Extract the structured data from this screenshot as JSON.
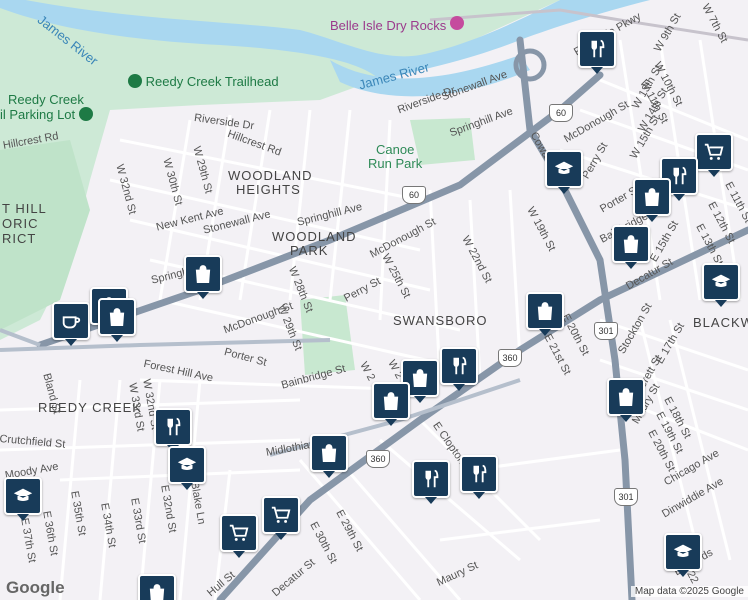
{
  "map": {
    "pois": {
      "belle_isle": "Belle Isle Dry Rocks",
      "trailhead": "Reedy Creek Trailhead",
      "parking_line1": "Reedy Creek",
      "parking_line2": "il Parking Lot",
      "canoe_line1": "Canoe",
      "canoe_line2": "Run Park",
      "historic_line1": "T HILL",
      "historic_line2": "ORIC",
      "historic_line3": "RICT"
    },
    "water": {
      "james_left": "James River",
      "james_right": "James River"
    },
    "neighborhoods": {
      "woodland_heights_1": "WOODLAND",
      "woodland_heights_2": "HEIGHTS",
      "woodland_park_1": "WOODLAND",
      "woodland_park_2": "PARK",
      "swansboro": "SWANSBORO",
      "reedy_creek": "REEDY CREEK",
      "blackwell": "BLACKW"
    },
    "streets": {
      "s1": "Hillcrest Rd",
      "s2": "Riverside Dr",
      "s3": "Hillcrest Rd",
      "s4": "W 29th St",
      "s5": "W 30th St",
      "s6": "W 32nd St",
      "s7": "New Kent Ave",
      "s8": "Stonewall Ave",
      "s9": "Springhill Ave",
      "s10": "McDonough St",
      "s11": "Perry St",
      "s12": "W 25th St",
      "s13": "W 22nd St",
      "s14": "W 28th St",
      "s15": "W 29th St",
      "s16": "McDonough St",
      "s17": "Porter St",
      "s18": "Forest Hill Ave",
      "s19": "Bainbridge St",
      "s20": "Riverside Dr",
      "s21": "Stonewall Ave",
      "s22": "Springhill Ave",
      "s23": "Cowardin Ave",
      "s24": "McDonough St",
      "s25": "W 19th St",
      "s26": "Perry St",
      "s27": "Porter St",
      "s28": "Bainbridge St",
      "s29": "E 20th St",
      "s30": "E 21st St",
      "s31": "Decatur St",
      "s32": "E 15th St",
      "s33": "Stockton St",
      "s34": "E 17th St",
      "s35": "Everett St",
      "s36": "Maury St",
      "s37": "E 18th St",
      "s38": "E 19th St",
      "s39": "E 20th St",
      "s40": "Chicago Ave",
      "s41": "Dinwiddie Ave",
      "s42": "W 7th St",
      "s43": "W 9th St",
      "s44": "W 10th St",
      "s45": "W 11th St",
      "s46": "W 13th St",
      "s47": "W 14th St",
      "s48": "W 15th St",
      "s49": "E 11th St",
      "s50": "E 12th St",
      "s51": "E 13th St",
      "s52": "Midlothian Tpke",
      "s53": "Crutchfield St",
      "s54": "Moody Ave",
      "s55": "Bland St",
      "s56": "W 33rd St",
      "s57": "W 32nd St",
      "s58": "E 32nd St",
      "s59": "Blake Ln",
      "s60": "E 34th St",
      "s61": "E 33rd St",
      "s62": "E 35th St",
      "s63": "E 36th St",
      "s64": "E 37th St",
      "s65": "Hull St",
      "s66": "Decatur St",
      "s67": "E 30th St",
      "s68": "E 29th St",
      "s69": "E Clopton St",
      "s70": "Maury St",
      "s71": "Edwards",
      "s72": "E 22",
      "s73": "Riverside Pkwy",
      "s74": "W 25th St",
      "s75": "Springhill",
      "s76": "W 21st St",
      "s77": "W 2"
    },
    "shields": {
      "r60a": "60",
      "r60b": "60",
      "r360a": "360",
      "r360b": "360",
      "r301a": "301",
      "r301b": "301"
    },
    "icons": {
      "cafe": "coffee-cup",
      "grocery": "shopping-bag",
      "restaurant": "fork-knife",
      "cart": "shopping-cart",
      "school": "graduation-cap"
    },
    "brand": "Google",
    "attribution": "Map data ©2025 Google",
    "colors": {
      "water": "#a9d7f0",
      "park": "#c8e8d0",
      "road_major": "#8796a8",
      "pin": "#183b59"
    }
  }
}
